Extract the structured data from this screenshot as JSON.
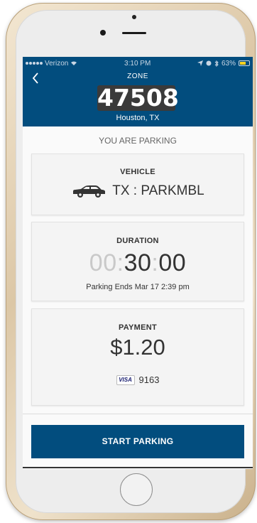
{
  "status_bar": {
    "carrier": "Verizon",
    "time": "3:10 PM",
    "battery": "63%",
    "battery_level": 0.63
  },
  "header": {
    "zone_label": "ZONE",
    "zone_number": "47508",
    "city": "Houston, TX"
  },
  "main": {
    "heading": "YOU ARE PARKING",
    "vehicle": {
      "title": "VEHICLE",
      "value": "TX : PARKMBL",
      "icon": "car-icon"
    },
    "duration": {
      "title": "DURATION",
      "hours": "00",
      "sep1": ":",
      "minutes": "30",
      "sep2": ":",
      "seconds": "00",
      "ends": "Parking Ends Mar 17 2:39 pm"
    },
    "payment": {
      "title": "PAYMENT",
      "amount": "$1.20",
      "card_brand": "VISA",
      "card_last4": "9163"
    },
    "start_button": "START PARKING"
  },
  "colors": {
    "brand_blue": "#024d7e",
    "zone_box": "#3a3a3a",
    "battery": "#ffd21f"
  }
}
